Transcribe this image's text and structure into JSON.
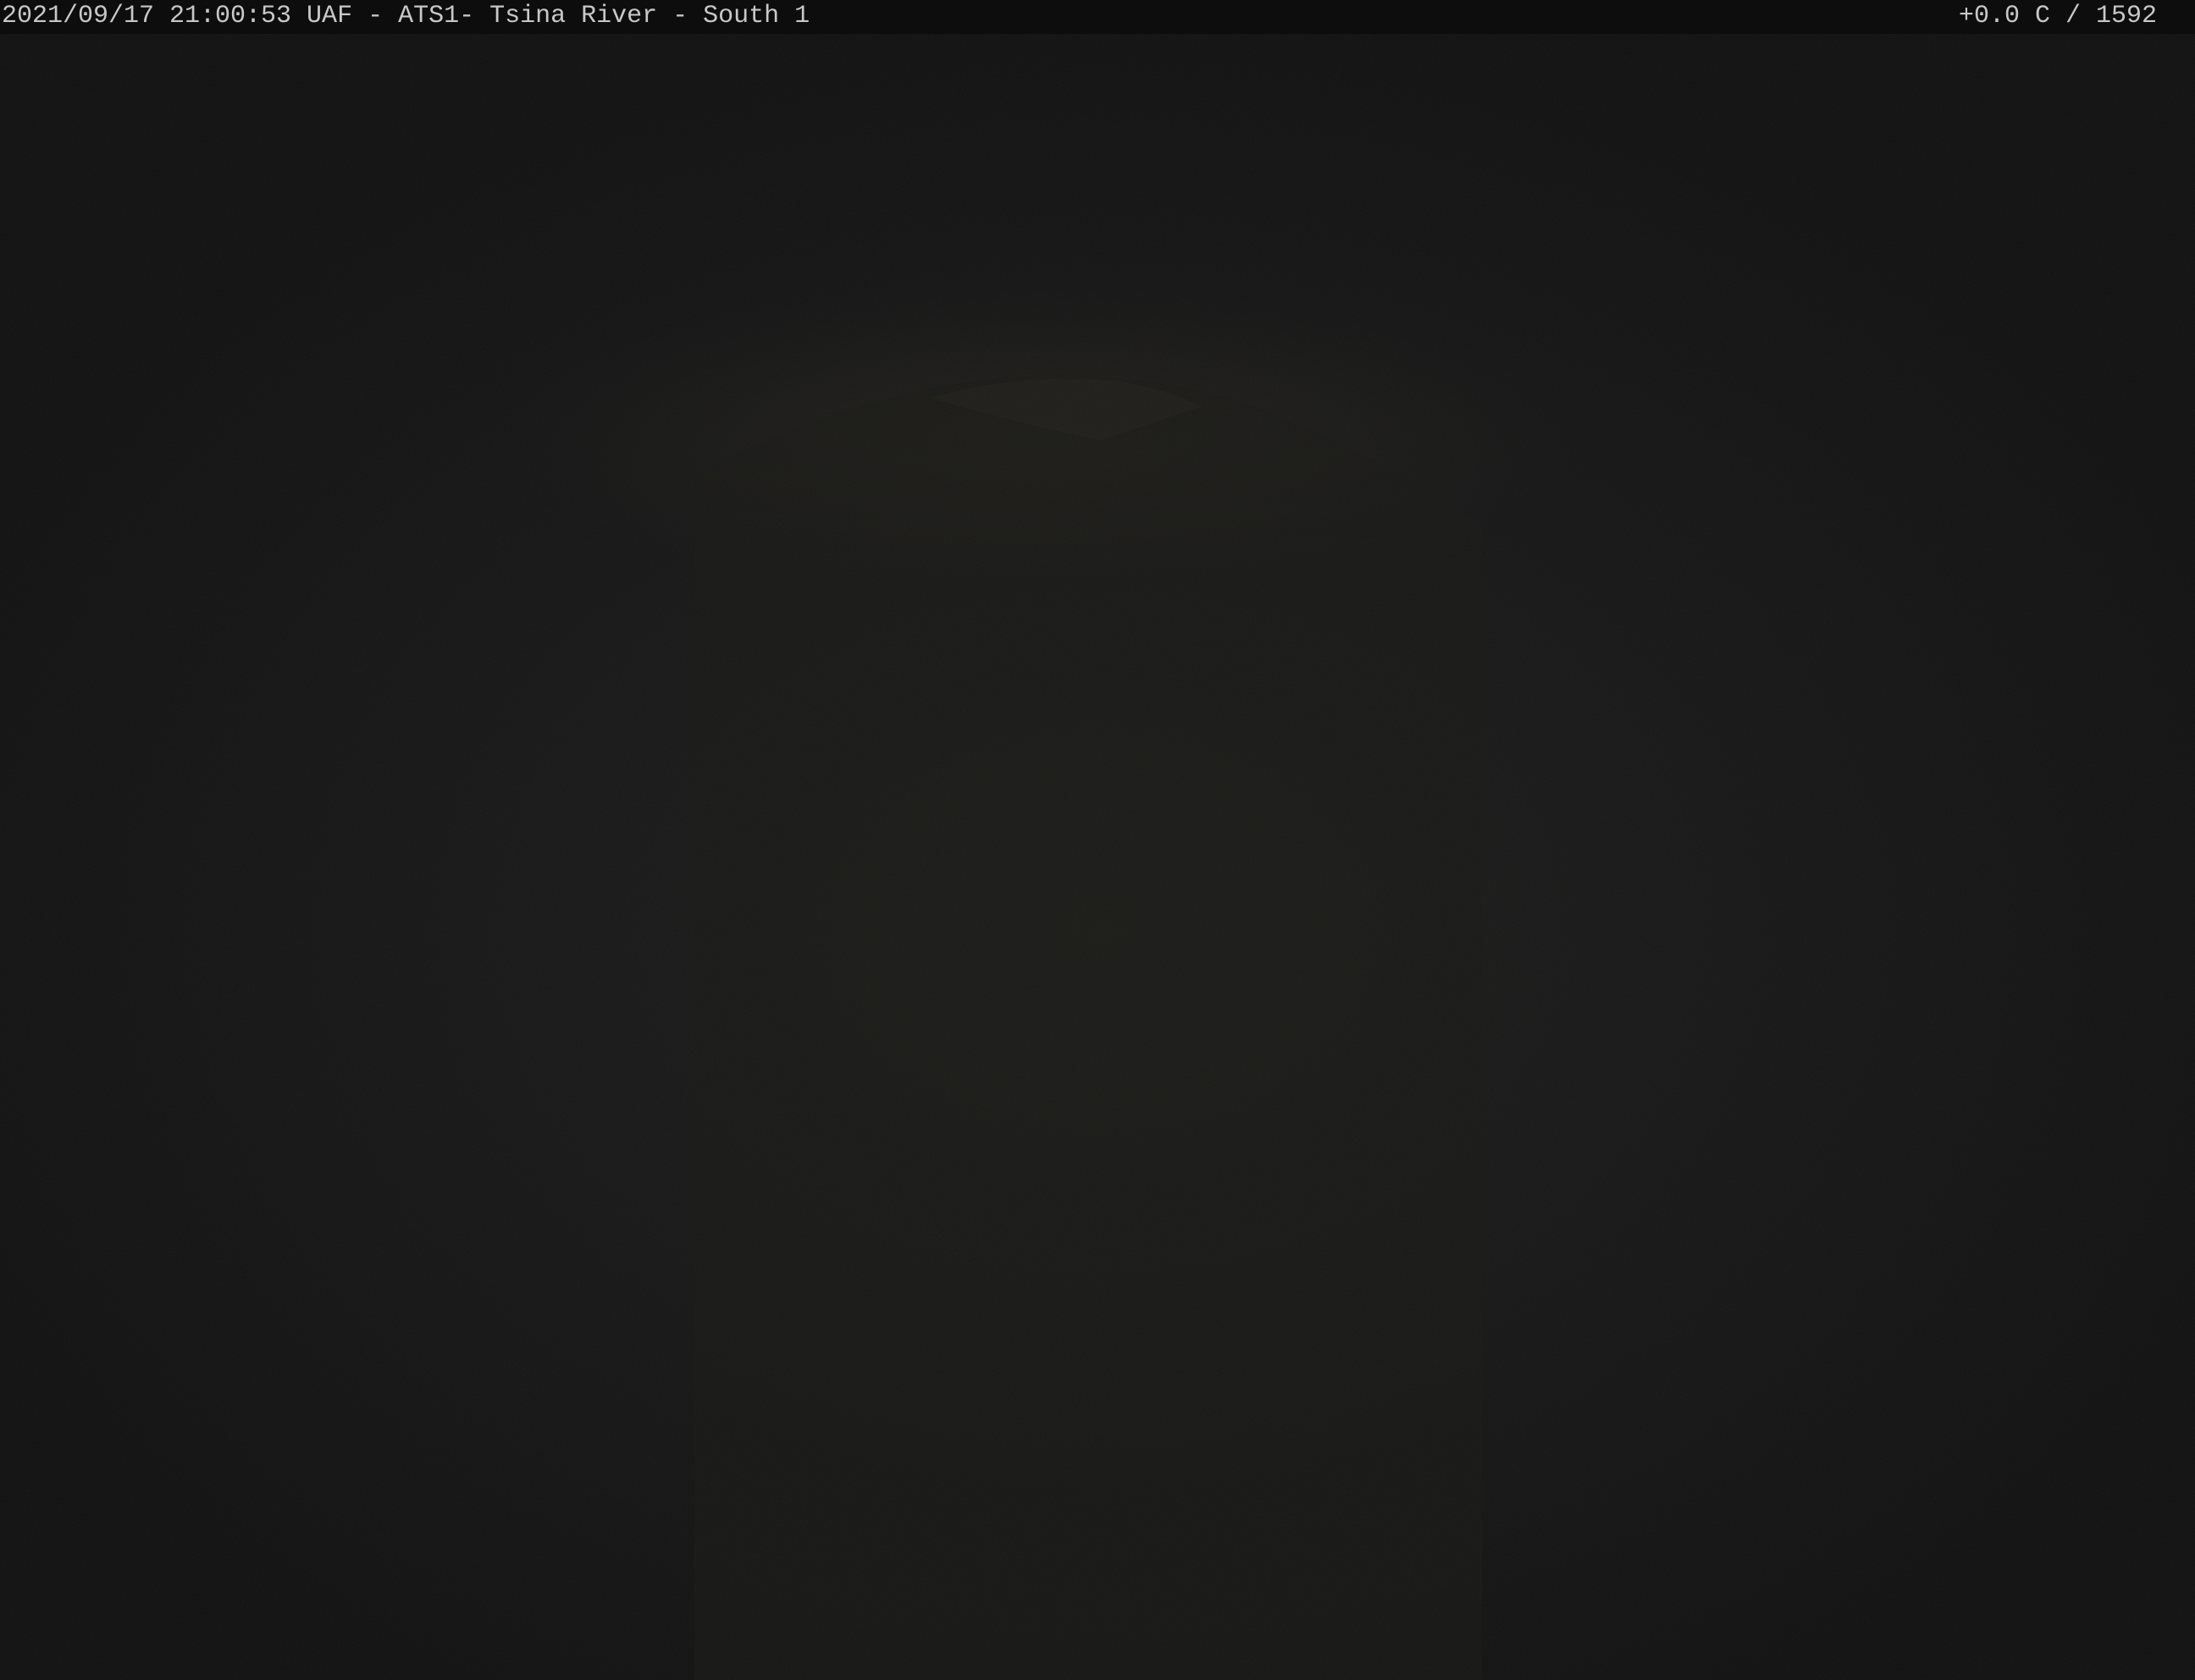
{
  "overlay": {
    "left_text": "2021/09/17 21:00:53 UAF - ATS1- Tsina River - South 1",
    "right_text": "+0.0 C / 1592"
  },
  "scene": {
    "description_icon": "dark-night-landscape",
    "colors": {
      "sky": "#151515",
      "caption_bar": "#0d0d0d",
      "caption_text": "#c8c8c8"
    }
  }
}
